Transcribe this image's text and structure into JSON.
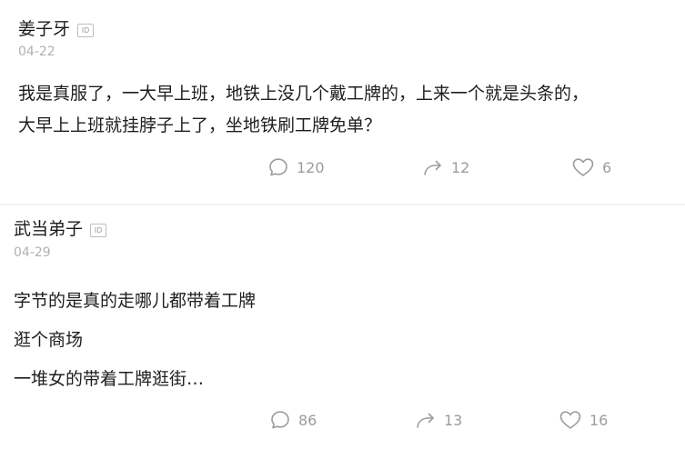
{
  "posts": [
    {
      "author": "姜子牙",
      "id_badge": "ID",
      "date": "04-22",
      "lines": [
        "我是真服了，一大早上班，地铁上没几个戴工牌的，上来一个就是头条的，",
        "大早上上班就挂脖子上了，坐地铁刷工牌免单？"
      ],
      "comments": "120",
      "reposts": "12",
      "likes": "6"
    },
    {
      "author": "武当弟子",
      "id_badge": "ID",
      "date": "04-29",
      "lines": [
        "字节的是真的走哪儿都带着工牌",
        "逛个商场",
        "一堆女的带着工牌逛街…"
      ],
      "comments": "86",
      "reposts": "13",
      "likes": "16"
    }
  ],
  "icons": {
    "comment": "comment-bubble-icon",
    "repost": "repost-arrow-icon",
    "like": "heart-icon"
  },
  "colors": {
    "icon_gray": "#9c9c9c",
    "date_gray": "#b0b0b0",
    "text": "#1e1e1e"
  }
}
